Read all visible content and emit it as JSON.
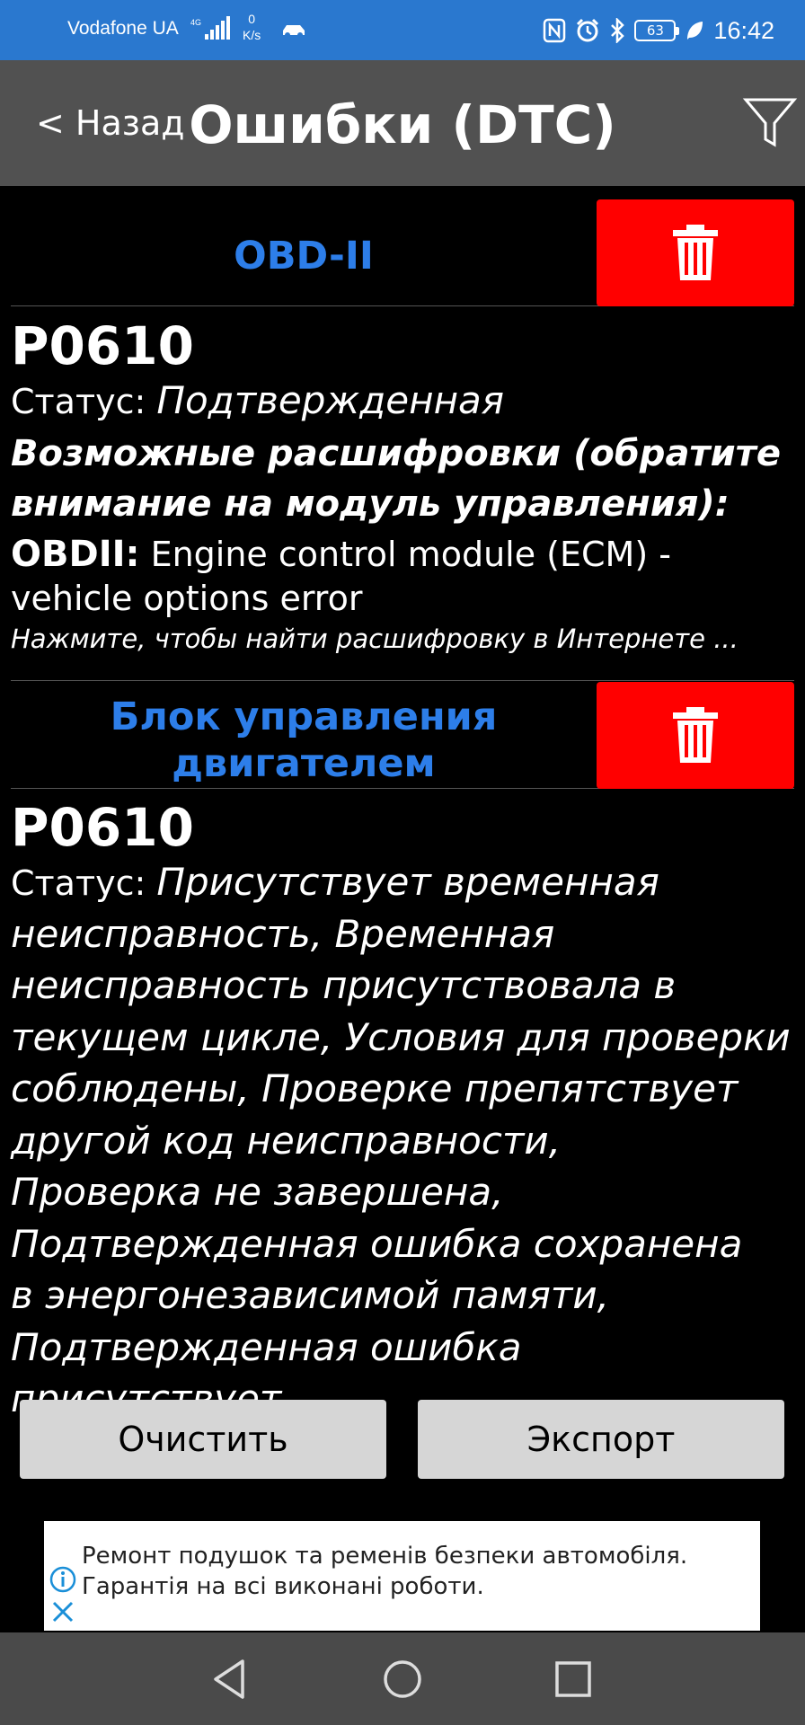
{
  "status_bar": {
    "carrier": "Vodafone UA",
    "network": "4G",
    "speed_value": "0",
    "speed_unit": "K/s",
    "battery": "63",
    "time": "16:42"
  },
  "header": {
    "back_label": "< Назад",
    "title": "Ошибки (DTC)"
  },
  "sections": [
    {
      "title": "OBD-II",
      "dtc": {
        "code": "P0610",
        "status_label": "Статус:",
        "status_value": "Подтвержденная",
        "possible_label": "Возможные расшифровки (обратите внимание на модуль управления):",
        "obd_label": "OBDII:",
        "obd_text": "Engine control module (ECM) - vehicle options error",
        "hint": "Нажмите, чтобы найти расшифровку в Интернете ..."
      }
    },
    {
      "title_line1": "Блок управления",
      "title_line2": "двигателем",
      "dtc": {
        "code": "P0610",
        "status_label": "Статус:",
        "status_lines": [
          "Присутствует временная",
          "неисправность, Временная",
          "неисправность присутствовала в",
          "текущем цикле, Условия для проверки",
          "соблюдены, Проверке препятствует",
          "другой код неисправности,",
          "Проверка не завершена,",
          "Подтвержденная ошибка сохранена",
          "в энергонезависимой памяти,",
          "Подтвержденная ошибка присутствует"
        ]
      }
    }
  ],
  "buttons": {
    "clear": "Очистить",
    "export": "Экспорт"
  },
  "ad": {
    "line1": "Ремонт подушок та ременів безпеки автомобіля.",
    "line2": "Гарантія на всі виконані роботи."
  },
  "colors": {
    "status_bar": "#2a78cf",
    "app_bar": "#515151",
    "section_title": "#2d7ee9",
    "delete_button": "#ff0000",
    "action_button": "#d6d6d6"
  }
}
